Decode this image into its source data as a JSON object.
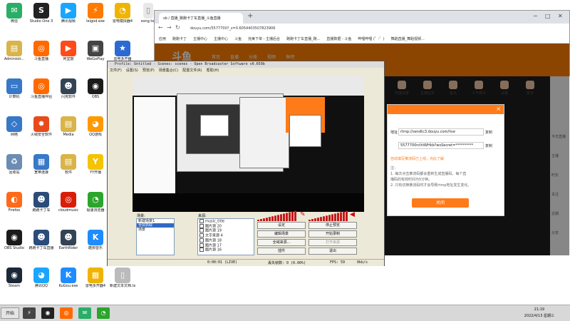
{
  "desktop": {
    "icons": [
      {
        "label": "微信",
        "glyph": "✉",
        "color": "#2aae67",
        "col": 0,
        "row": 0
      },
      {
        "label": "Studio One 3",
        "glyph": "S",
        "color": "#222222",
        "col": 1,
        "row": 0
      },
      {
        "label": "腾讯视频",
        "glyph": "▶",
        "color": "#1aa6ff",
        "col": 2,
        "row": 0
      },
      {
        "label": "leigod.exe",
        "glyph": "⚡",
        "color": "#ff7a00",
        "col": 3,
        "row": 0
      },
      {
        "label": "雷电模拟器4",
        "glyph": "◔",
        "color": "#f0b400",
        "col": 4,
        "row": 0
      },
      {
        "label": "Administr...",
        "glyph": "▤",
        "color": "#d9b44a",
        "col": 0,
        "row": 1
      },
      {
        "label": "斗鱼直播",
        "glyph": "◎",
        "color": "#ff6a00",
        "col": 1,
        "row": 1
      },
      {
        "label": "阿里鼓",
        "glyph": "▶",
        "color": "#ff4a1a",
        "col": 2,
        "row": 1
      },
      {
        "label": "WeGoPlay",
        "glyph": "▣",
        "color": "#444444",
        "col": 3,
        "row": 1
      },
      {
        "label": "雷电多开器",
        "glyph": "★",
        "color": "#2b6ad3",
        "col": 4,
        "row": 1
      },
      {
        "label": "计算机",
        "glyph": "▭",
        "color": "#3778c8",
        "col": 0,
        "row": 2
      },
      {
        "label": "斗鱼直播伴侣",
        "glyph": "◎",
        "color": "#ff6a00",
        "col": 1,
        "row": 2
      },
      {
        "label": "闪克软件",
        "glyph": "☻",
        "color": "#334455",
        "col": 2,
        "row": 2
      },
      {
        "label": "OBS",
        "glyph": "◉",
        "color": "#1b1b1b",
        "col": 3,
        "row": 2
      },
      {
        "label": "网络",
        "glyph": "◇",
        "color": "#3778c8",
        "col": 0,
        "row": 3
      },
      {
        "label": "火绒安全软件",
        "glyph": "✹",
        "color": "#e84a1a",
        "col": 1,
        "row": 3
      },
      {
        "label": "Media",
        "glyph": "▤",
        "color": "#d9b44a",
        "col": 2,
        "row": 3
      },
      {
        "label": "QQ游戏",
        "glyph": "◕",
        "color": "#ff9900",
        "col": 3,
        "row": 3
      },
      {
        "label": "回收站",
        "glyph": "♻",
        "color": "#6b8db3",
        "col": 0,
        "row": 4
      },
      {
        "label": "宽带连接",
        "glyph": "▦",
        "color": "#3778c8",
        "col": 1,
        "row": 4
      },
      {
        "label": "软件",
        "glyph": "▤",
        "color": "#d9b44a",
        "col": 2,
        "row": 4
      },
      {
        "label": "YY开播",
        "glyph": "Y",
        "color": "#f4c400",
        "col": 3,
        "row": 4
      },
      {
        "label": "Firefox",
        "glyph": "◐",
        "color": "#ff6a1a",
        "col": 0,
        "row": 5
      },
      {
        "label": "跑跑卡丁车",
        "glyph": "☻",
        "color": "#2b4c7a",
        "col": 1,
        "row": 5
      },
      {
        "label": "cloudmusic",
        "glyph": "◎",
        "color": "#d81e06",
        "col": 2,
        "row": 5
      },
      {
        "label": "极速浏览器",
        "glyph": "◔",
        "color": "#2ba52b",
        "col": 3,
        "row": 5
      },
      {
        "label": "OBS Studio",
        "glyph": "◉",
        "color": "#1b1b1b",
        "col": 0,
        "row": 6
      },
      {
        "label": "跑跑卡丁车直播",
        "glyph": "☻",
        "color": "#2b4c7a",
        "col": 1,
        "row": 6
      },
      {
        "label": "EarthRider",
        "glyph": "☻",
        "color": "#334455",
        "col": 2,
        "row": 6
      },
      {
        "label": "酷狗音乐",
        "glyph": "K",
        "color": "#1e8cff",
        "col": 3,
        "row": 6
      },
      {
        "label": "Steam",
        "glyph": "◉",
        "color": "#1b2838",
        "col": 0,
        "row": 7
      },
      {
        "label": "腾讯QQ",
        "glyph": "◕",
        "color": "#1aa6ff",
        "col": 1,
        "row": 7
      },
      {
        "label": "KuGou.exe",
        "glyph": "K",
        "color": "#1e8cff",
        "col": 2,
        "row": 7
      },
      {
        "label": "雷电多开器4",
        "glyph": "▦",
        "color": "#f0b400",
        "col": 3,
        "row": 7
      },
      {
        "label": "新建文本文档.txt",
        "glyph": "▯",
        "color": "#bbbbbb",
        "col": 4,
        "row": 7
      }
    ],
    "top_file": "song.txt"
  },
  "browser": {
    "tab_title": "sb / 直播_跑跑卡丁车直播_斗鱼直播",
    "new_tab": "+",
    "url": "douyu.com/5577700?_z=0.6054403507823906",
    "bookmarks": [
      "应用",
      "跑跑卡丁",
      "主播中心",
      "主播中心",
      "斗鱼",
      "完美下单 - 主播后台",
      "跑跑卡丁车直播_跑...",
      "直播数据 - 斗鱼",
      "哔哩哔哩 (゜-゜)",
      "舞蹈直播_舞蹈视频..."
    ],
    "site_logo": "斗鱼",
    "site_nav": [
      "首页",
      "直播",
      "分类",
      "视频",
      "鱼吧"
    ],
    "tools": [
      {
        "label": "开播设置",
        "color": "#f3c6a8"
      },
      {
        "label": "主播任务",
        "color": "#f3c6a8"
      },
      {
        "label": "鱼丸",
        "color": "#f3c6a8"
      },
      {
        "label": "人气排行",
        "color": "#f3c6a8"
      },
      {
        "label": "设置",
        "color": "#f3c6a8"
      },
      {
        "label": "更多",
        "color": "#f3c6a8"
      }
    ],
    "right_panel_text": [
      "今日直播",
      "主播",
      "时长",
      "关注",
      "近期",
      "分享"
    ]
  },
  "modal": {
    "server_label": "地址",
    "server_url": "rtmp://sendtc3.douyu.com/live",
    "server_copy": "复制",
    "key_value": "5577700rcIhiWHkb?wsSecret=**********",
    "key_copy": "复制",
    "warning": "自动填写推流码已上线，点此了解",
    "notes": [
      "注：",
      "1. 每次点击推流码都会重新生成直播码，每个直",
      "播码的有效时间为5分钟。",
      "2. 只有切换推流码时才会导致rtmp地址发生变化。"
    ],
    "button": "关闭",
    "close": "×"
  },
  "obs": {
    "title": "Profile: Untitled - Scenes: scenes - Open Broadcaster Software v0.659b",
    "menu": [
      "文件(F)",
      "设置(S)",
      "预览(P)",
      "场景集合(C)",
      "配置文件(R)",
      "帮助(H)"
    ],
    "scenes_label": "场景:",
    "sources_label": "来源:",
    "scenes": [
      "新建场景1",
      "全屏抓取",
      "场景"
    ],
    "selected_scene_index": 1,
    "sources": [
      "music_title",
      "图片源 20",
      "图片源 19",
      "文字来源 4",
      "图片源 18",
      "图片源 17",
      "图片源 16"
    ],
    "buttons": {
      "settings": "设定",
      "stop_preview": "停止预览",
      "edit_scene": "编辑场景",
      "start_record": "开始录制",
      "global_sources": "全域来源...",
      "plugins": "插件",
      "exit": "退出",
      "test_stream": "打开来源"
    },
    "status": {
      "time": "0:00:01 (LIVE)",
      "dropped": "丢失帧数: 0 (0.00%)",
      "fps": "FPS: 59",
      "bitrate": "0kb/s"
    }
  },
  "taskbar": {
    "start": "开始",
    "time": "21:19",
    "date": "2022/4/13 星期三",
    "apps": [
      {
        "glyph": "⚡",
        "color": "#444"
      },
      {
        "glyph": "◉",
        "color": "#222"
      },
      {
        "glyph": "◎",
        "color": "#ff6a00"
      },
      {
        "glyph": "✉",
        "color": "#2aae67"
      },
      {
        "glyph": "◔",
        "color": "#2ba52b"
      }
    ]
  }
}
